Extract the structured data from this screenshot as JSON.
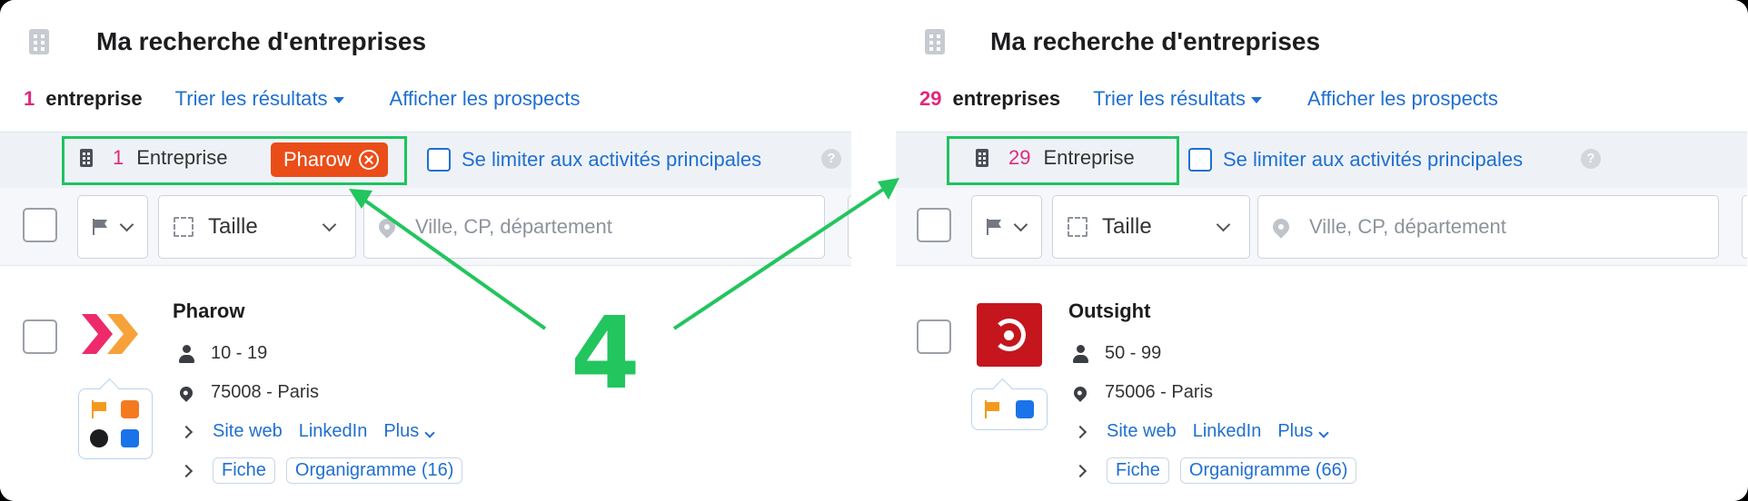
{
  "left": {
    "title": "Ma recherche d'entreprises",
    "count": "1",
    "count_label": "entreprise",
    "sort_label": "Trier les résultats",
    "prospects_label": "Afficher les prospects",
    "filter": {
      "count": "1",
      "label": "Entreprise",
      "tag": "Pharow"
    },
    "limit_label": "Se limiter aux activités principales",
    "help": "?",
    "size_label": "Taille",
    "location_placeholder": "Ville, CP, département",
    "company": {
      "name": "Pharow",
      "employees": "10 - 19",
      "location": "75008 - Paris",
      "site": "Site web",
      "linkedin": "LinkedIn",
      "more": "Plus",
      "fiche": "Fiche",
      "org": "Organigramme (16)"
    }
  },
  "right": {
    "title": "Ma recherche d'entreprises",
    "count": "29",
    "count_label": "entreprises",
    "sort_label": "Trier les résultats",
    "prospects_label": "Afficher les prospects",
    "filter": {
      "count": "29",
      "label": "Entreprise"
    },
    "limit_label": "Se limiter aux activités principales",
    "help": "?",
    "size_label": "Taille",
    "location_placeholder": "Ville, CP, département",
    "company": {
      "name": "Outsight",
      "employees": "50 - 99",
      "location": "75006 - Paris",
      "site": "Site web",
      "linkedin": "LinkedIn",
      "more": "Plus",
      "fiche": "Fiche",
      "org": "Organigramme (66)"
    }
  },
  "annotation": {
    "step": "4"
  },
  "colors": {
    "accent": "#1f6fd1",
    "highlight": "#20c35f",
    "count": "#e0297a",
    "tag": "#ea4d18",
    "outsight_logo": "#c4161c"
  }
}
